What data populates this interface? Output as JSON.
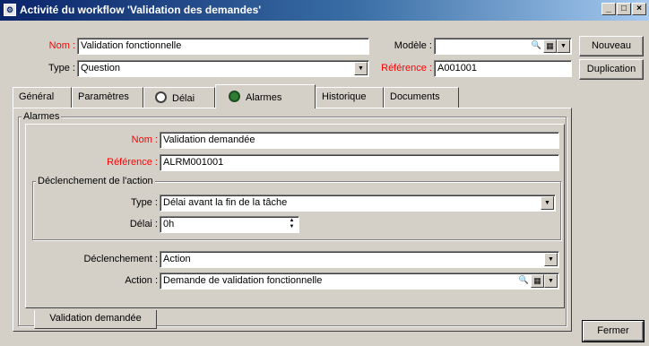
{
  "window": {
    "title": "Activité du workflow 'Validation des demandes'",
    "app_icon": "workflow-icon",
    "controls": [
      "_",
      "□",
      "×"
    ]
  },
  "header": {
    "nom_label": "Nom :",
    "nom_value": "Validation fonctionnelle",
    "type_label": "Type :",
    "type_value": "Question",
    "modele_label": "Modèle :",
    "modele_value": "",
    "reference_label": "Référence :",
    "reference_value": "A001001"
  },
  "side_buttons": {
    "nouveau": "Nouveau",
    "duplication": "Duplication",
    "fermer": "Fermer"
  },
  "tabs": [
    {
      "label": "Général",
      "icon": ""
    },
    {
      "label": "Paramètres",
      "icon": ""
    },
    {
      "label": "Délai",
      "icon": "clock-icon"
    },
    {
      "label": "Alarmes",
      "icon": "alarm-icon",
      "active": true
    },
    {
      "label": "Historique",
      "icon": ""
    },
    {
      "label": "Documents",
      "icon": ""
    }
  ],
  "alarms": {
    "group_title": "Alarmes",
    "nom_label": "Nom :",
    "nom_value": "Validation demandée",
    "reference_label": "Référence :",
    "reference_value": "ALRM001001",
    "trigger_group_title": "Déclenchement de l'action",
    "type_label": "Type :",
    "type_value": "Délai avant la fin de la tâche",
    "delai_label": "Délai :",
    "delai_value": "0h",
    "declenchement_label": "Déclenchement :",
    "declenchement_value": "Action",
    "action_label": "Action :",
    "action_value": "Demande de validation fonctionnelle",
    "bottom_tab": "Validation demandée"
  },
  "colors": {
    "required_label": "#ff0000",
    "titlebar_start": "#0a246a",
    "titlebar_end": "#a6caf0",
    "window_face": "#d4d0c8"
  }
}
